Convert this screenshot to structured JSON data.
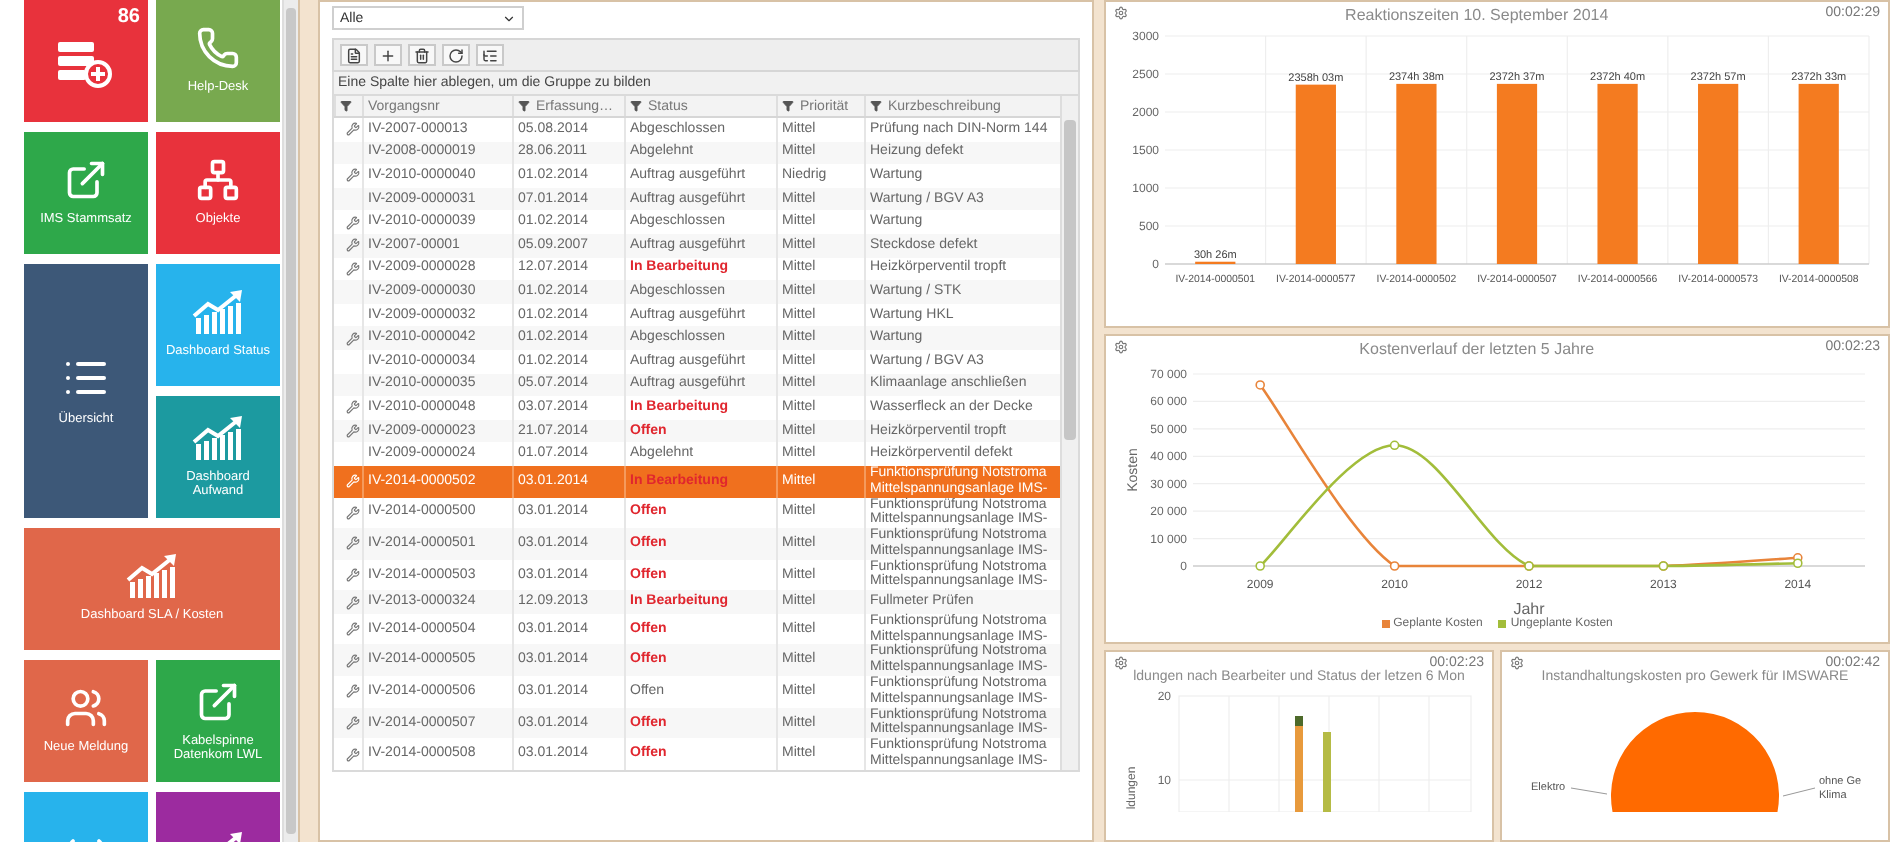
{
  "left_panel": {
    "tiles": [
      {
        "kind": "server",
        "color": "#e8323c",
        "tall": false,
        "wide": false,
        "badge": "86"
      },
      {
        "label": "Help-Desk",
        "kind": "phone",
        "color": "#78a94f",
        "tall": false,
        "wide": false
      },
      {
        "label": "IMS Stammsatz",
        "kind": "external",
        "color": "#2ea84a",
        "tall": false,
        "wide": false
      },
      {
        "label": "Objekte",
        "kind": "hierarchy",
        "color": "#e8323c",
        "tall": false,
        "wide": false
      },
      {
        "label": "Übersicht",
        "kind": "list",
        "color": "#3d5878",
        "tall": true,
        "wide": false
      },
      {
        "label": "Dashboard Status",
        "kind": "chart",
        "color": "#27b3ec",
        "tall": false,
        "wide": false
      },
      {
        "label": "Dashboard Aufwand",
        "kind": "chart",
        "color": "#1c9aa0",
        "tall": false,
        "wide": false
      },
      {
        "label": "Dashboard SLA / Kosten",
        "kind": "chart",
        "color": "#e0674a",
        "tall": false,
        "wide": true
      },
      {
        "label": "Neue Meldung",
        "kind": "people",
        "color": "#e0674a",
        "tall": false,
        "wide": false
      },
      {
        "label": "Kabelspinne Datenkom LWL",
        "kind": "external",
        "color": "#2ea84a",
        "tall": false,
        "wide": false
      },
      {
        "kind": "wifi",
        "color": "#27b3ec",
        "tall": false,
        "wide": false
      },
      {
        "kind": "chart",
        "color": "#9c2b9f",
        "tall": false,
        "wide": false
      }
    ]
  },
  "list_panel": {
    "filter": {
      "value": "Alle"
    },
    "toolbar": [
      {
        "kind": "new"
      },
      {
        "kind": "add"
      },
      {
        "kind": "delete"
      },
      {
        "kind": "refresh"
      },
      {
        "kind": "tree"
      }
    ],
    "group_hint": "Eine Spalte hier ablegen, um die Gruppe zu bilden",
    "columns": [
      "Vorgangsnr",
      "Erfassung…",
      "Status",
      "Priorität",
      "Kurzbeschreibung"
    ],
    "rows": [
      {
        "marked": true,
        "number": "IV-2007-000013",
        "date": "05.08.2014",
        "status": "Abgeschlossen",
        "urgent": false,
        "priority": "Mittel",
        "description": "Prüfung nach DIN-Norm 144",
        "selected": false
      },
      {
        "marked": false,
        "number": "IV-2008-0000019",
        "date": "28.06.2011",
        "status": "Abgelehnt",
        "urgent": false,
        "priority": "Mittel",
        "description": "Heizung defekt",
        "selected": false
      },
      {
        "marked": true,
        "number": "IV-2010-0000040",
        "date": "01.02.2014",
        "status": "Auftrag ausgeführt",
        "urgent": false,
        "priority": "Niedrig",
        "description": "Wartung",
        "selected": false
      },
      {
        "marked": false,
        "number": "IV-2009-0000031",
        "date": "07.01.2014",
        "status": "Auftrag ausgeführt",
        "urgent": false,
        "priority": "Mittel",
        "description": "Wartung / BGV A3",
        "selected": false
      },
      {
        "marked": true,
        "number": "IV-2010-0000039",
        "date": "01.02.2014",
        "status": "Abgeschlossen",
        "urgent": false,
        "priority": "Mittel",
        "description": "Wartung",
        "selected": false
      },
      {
        "marked": true,
        "number": "IV-2007-00001",
        "date": "05.09.2007",
        "status": "Auftrag ausgeführt",
        "urgent": false,
        "priority": "Mittel",
        "description": "Steckdose defekt",
        "selected": false
      },
      {
        "marked": true,
        "number": "IV-2009-0000028",
        "date": "12.07.2014",
        "status": "In Bearbeitung",
        "urgent": true,
        "priority": "Mittel",
        "description": "Heizkörperventil tropft",
        "selected": false
      },
      {
        "marked": false,
        "number": "IV-2009-0000030",
        "date": "01.02.2014",
        "status": "Abgeschlossen",
        "urgent": false,
        "priority": "Mittel",
        "description": "Wartung / STK",
        "selected": false
      },
      {
        "marked": false,
        "number": "IV-2009-0000032",
        "date": "01.02.2014",
        "status": "Auftrag ausgeführt",
        "urgent": false,
        "priority": "Mittel",
        "description": "Wartung HKL",
        "selected": false
      },
      {
        "marked": true,
        "number": "IV-2010-0000042",
        "date": "01.02.2014",
        "status": "Abgeschlossen",
        "urgent": false,
        "priority": "Mittel",
        "description": "Wartung",
        "selected": false
      },
      {
        "marked": false,
        "number": "IV-2010-0000034",
        "date": "01.02.2014",
        "status": "Auftrag ausgeführt",
        "urgent": false,
        "priority": "Mittel",
        "description": "Wartung / BGV A3",
        "selected": false
      },
      {
        "marked": false,
        "number": "IV-2010-0000035",
        "date": "05.07.2014",
        "status": "Auftrag ausgeführt",
        "urgent": false,
        "priority": "Mittel",
        "description": "Klimaanlage anschließen",
        "selected": false
      },
      {
        "marked": true,
        "number": "IV-2010-0000048",
        "date": "03.07.2014",
        "status": "In Bearbeitung",
        "urgent": true,
        "priority": "Mittel",
        "description": "Wasserfleck an der Decke",
        "selected": false
      },
      {
        "marked": true,
        "number": "IV-2009-0000023",
        "date": "21.07.2014",
        "status": "Offen",
        "urgent": true,
        "priority": "Mittel",
        "description": "Heizkörperventil tropft",
        "selected": false
      },
      {
        "marked": false,
        "number": "IV-2009-0000024",
        "date": "01.07.2014",
        "status": "Abgelehnt",
        "urgent": false,
        "priority": "Mittel",
        "description": "Heizkörperventil defekt",
        "selected": false
      },
      {
        "marked": true,
        "number": "IV-2014-0000502",
        "date": "03.01.2014",
        "status": "In Bearbeitung",
        "urgent": true,
        "priority": "Mittel",
        "description": "Funktionsprüfung Notstroma\nMittelspannungsanlage IMS-",
        "selected": true
      },
      {
        "marked": true,
        "number": "IV-2014-0000500",
        "date": "03.01.2014",
        "status": "Offen",
        "urgent": true,
        "priority": "Mittel",
        "description": "Funktionsprüfung Notstroma\nMittelspannungsanlage IMS-",
        "selected": false
      },
      {
        "marked": true,
        "number": "IV-2014-0000501",
        "date": "03.01.2014",
        "status": "Offen",
        "urgent": true,
        "priority": "Mittel",
        "description": "Funktionsprüfung Notstroma\nMittelspannungsanlage IMS-",
        "selected": false
      },
      {
        "marked": true,
        "number": "IV-2014-0000503",
        "date": "03.01.2014",
        "status": "Offen",
        "urgent": true,
        "priority": "Mittel",
        "description": "Funktionsprüfung Notstroma\nMittelspannungsanlage IMS-",
        "selected": false
      },
      {
        "marked": true,
        "number": "IV-2013-0000324",
        "date": "12.09.2013",
        "status": "In Bearbeitung",
        "urgent": true,
        "priority": "Mittel",
        "description": "Fullmeter Prüfen",
        "selected": false
      },
      {
        "marked": true,
        "number": "IV-2014-0000504",
        "date": "03.01.2014",
        "status": "Offen",
        "urgent": true,
        "priority": "Mittel",
        "description": "Funktionsprüfung Notstroma\nMittelspannungsanlage IMS-",
        "selected": false
      },
      {
        "marked": true,
        "number": "IV-2014-0000505",
        "date": "03.01.2014",
        "status": "Offen",
        "urgent": true,
        "priority": "Mittel",
        "description": "Funktionsprüfung Notstroma\nMittelspannungsanlage IMS-",
        "selected": false
      },
      {
        "marked": true,
        "number": "IV-2014-0000506",
        "date": "03.01.2014",
        "status": "Offen",
        "urgent": false,
        "priority": "Mittel",
        "description": "Funktionsprüfung Notstroma\nMittelspannungsanlage IMS-",
        "selected": false
      },
      {
        "marked": true,
        "number": "IV-2014-0000507",
        "date": "03.01.2014",
        "status": "Offen",
        "urgent": true,
        "priority": "Mittel",
        "description": "Funktionsprüfung Notstroma\nMittelspannungsanlage IMS-",
        "selected": false
      },
      {
        "marked": true,
        "number": "IV-2014-0000508",
        "date": "03.01.2014",
        "status": "Offen",
        "urgent": true,
        "priority": "Mittel",
        "description": "Funktionsprüfung Notstroma\nMittelspannungsanlage IMS-",
        "selected": false
      }
    ]
  },
  "dashboard": {
    "panels": [
      {
        "time": "00:02:29",
        "chart_data": {
          "type": "bar",
          "title": "Reaktionszeiten 10. September 2014",
          "categories": [
            "IV-2014-0000501",
            "IV-2014-0000577",
            "IV-2014-0000502",
            "IV-2014-0000507",
            "IV-2014-0000566",
            "IV-2014-0000573",
            "IV-2014-0000508"
          ],
          "series": [
            {
              "color": "#f47b20",
              "values": [
                30,
                2360,
                2370,
                2370,
                2370,
                2370,
                2370
              ]
            }
          ],
          "grid": true,
          "value_labels": [
            "30h 26m",
            "2358h 03m",
            "2374h 38m",
            "2372h 37m",
            "2372h 40m",
            "2372h 57m",
            "2372h 33m"
          ],
          "ylim": [
            0,
            3000
          ],
          "yticks": [
            0,
            500,
            1000,
            1500,
            2000,
            2500,
            3000
          ]
        }
      },
      {
        "time": "00:02:23",
        "chart_data": {
          "type": "line",
          "title": "Kostenverlauf der letzten 5 Jahre",
          "xlabel": "Jahr",
          "ylabel": "Kosten",
          "categories": [
            "2009",
            "2010",
            "2012",
            "2013",
            "2014"
          ],
          "grid": true,
          "series": [
            {
              "name": "Geplante Kosten",
              "color": "#e8843a",
              "values": [
                66000,
                0,
                0,
                0,
                3000
              ],
              "marker": true
            },
            {
              "name": "Ungeplante Kosten",
              "color": "#a2bd3a",
              "values": [
                0,
                44000,
                0,
                0,
                1000
              ],
              "marker": true
            }
          ],
          "ylim": [
            0,
            70000
          ],
          "yticks": [
            {
              "value": 0,
              "label": "0"
            },
            {
              "value": 10000,
              "label": "10 000"
            },
            {
              "value": 20000,
              "label": "20 000"
            },
            {
              "value": 30000,
              "label": "30 000"
            },
            {
              "value": 40000,
              "label": "40 000"
            },
            {
              "value": 50000,
              "label": "50 000"
            },
            {
              "value": 60000,
              "label": "60 000"
            },
            {
              "value": 70000,
              "label": "70 000"
            }
          ]
        }
      },
      {
        "kind": "stacked",
        "time": "00:02:23",
        "title": "ldungen nach Bearbeiter und Status der letzen 6 Mon",
        "ylabel": "ldungen",
        "tick_labels": [
          "20",
          "10"
        ]
      },
      {
        "kind": "pie",
        "time": "00:02:42",
        "title": "Instandhaltungskosten pro Gewerk für IMSWARE",
        "slice_labels": [
          "Elektro",
          "ohne Ge",
          "Klima"
        ]
      }
    ]
  }
}
